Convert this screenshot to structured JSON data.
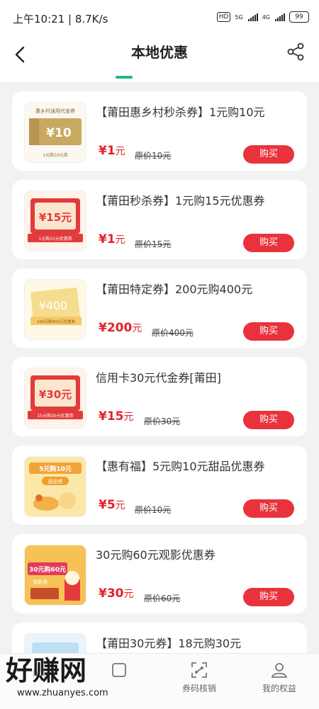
{
  "status_bar": {
    "time": "上午10:21 | 8.7K/s",
    "hd": "HD",
    "net1": "5G",
    "net2": "4G",
    "battery": "99"
  },
  "header": {
    "title": "本地优惠"
  },
  "coupons": [
    {
      "title": "【莆田惠乡村秒杀券】1元购10元",
      "price": "¥1",
      "unit": "元",
      "original": "原价10元",
      "buy": "购买",
      "thumb_text": "¥10",
      "thumb_caption": "惠乡村通用代金券",
      "thumb_sub": "1元购10元券"
    },
    {
      "title": "【莆田秒杀券】1元购15元优惠券",
      "price": "¥1",
      "unit": "元",
      "original": "原价15元",
      "buy": "购买",
      "thumb_text": "¥15元",
      "thumb_sub": "1元购15元优惠券"
    },
    {
      "title": "【莆田特定券】200元购400元",
      "price": "¥200",
      "unit": "元",
      "original": "原价400元",
      "buy": "购买",
      "thumb_text": "¥400",
      "thumb_sub": "200元购400元优惠券"
    },
    {
      "title": "信用卡30元代金券[莆田]",
      "price": "¥15",
      "unit": "元",
      "original": "原价30元",
      "buy": "购买",
      "thumb_text": "¥30元",
      "thumb_sub": "15元购30元优惠券"
    },
    {
      "title": "【惠有福】5元购10元甜品优惠券",
      "price": "¥5",
      "unit": "元",
      "original": "原价10元",
      "buy": "购买",
      "thumb_text": "5元购10元",
      "thumb_sub": "甜品券"
    },
    {
      "title": "30元购60元观影优惠券",
      "price": "¥30",
      "unit": "元",
      "original": "原价60元",
      "buy": "购买",
      "thumb_text": "30元购60元",
      "thumb_sub": "观影券"
    },
    {
      "title": "【莆田30元券】18元购30元"
    }
  ],
  "bottom_nav": [
    {
      "label": "",
      "icon": "home-icon"
    },
    {
      "label": "",
      "icon": "activity-icon"
    },
    {
      "label": "券码核销",
      "icon": "scan-icon"
    },
    {
      "label": "我的权益",
      "icon": "user-icon"
    }
  ],
  "watermark": {
    "text": "好赚网",
    "url": "www.zhuanyes.com"
  },
  "colors": {
    "accent": "#26b28a",
    "price_red": "#e5202b",
    "buy_button": "#e8333c"
  }
}
